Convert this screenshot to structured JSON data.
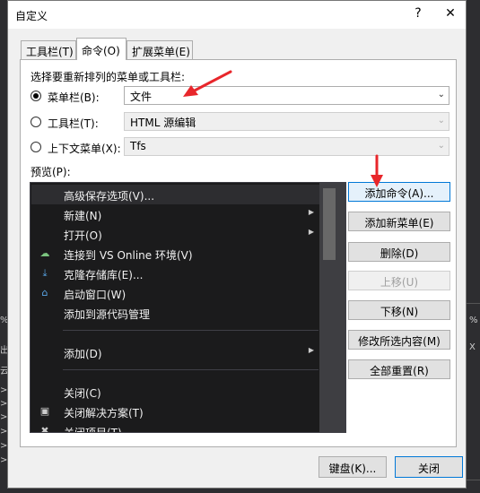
{
  "background": {
    "left_glyphs": [
      "%",
      "出",
      "云",
      "",
      ">",
      ">",
      ">",
      ">",
      ">",
      ">"
    ],
    "right_glyphs": [
      "%",
      "X"
    ]
  },
  "dialog": {
    "title": "自定义",
    "help_label": "?",
    "close_glyph": "✕"
  },
  "tabs": [
    {
      "label": "工具栏(T)",
      "active": false
    },
    {
      "label": "命令(O)",
      "active": true
    },
    {
      "label": "扩展菜单(E)",
      "active": false
    }
  ],
  "choose_label": "选择要重新排列的菜单或工具栏:",
  "options": [
    {
      "label": "菜单栏(B):",
      "value": "文件",
      "checked": true,
      "enabled": true
    },
    {
      "label": "工具栏(T):",
      "value": "HTML 源编辑",
      "checked": false,
      "enabled": false
    },
    {
      "label": "上下文菜单(X):",
      "value": "Tfs",
      "checked": false,
      "enabled": false
    }
  ],
  "preview_label": "预览(P):",
  "menu_items": [
    {
      "text": "高级保存选项(V)...",
      "icon": "",
      "submenu": false
    },
    {
      "text": "新建(N)",
      "icon": "",
      "submenu": true
    },
    {
      "text": "打开(O)",
      "icon": "",
      "submenu": true
    },
    {
      "text": "连接到 VS Online 环境(V)",
      "icon": "☁",
      "submenu": false
    },
    {
      "text": "克隆存储库(E)...",
      "icon": "⤓",
      "submenu": false
    },
    {
      "text": "启动窗口(W)",
      "icon": "⌂",
      "submenu": false
    },
    {
      "text": "添加到源代码管理",
      "icon": "",
      "submenu": false
    },
    {
      "text": "添加(D)",
      "icon": "",
      "submenu": true
    },
    {
      "text": "关闭(C)",
      "icon": "",
      "submenu": false
    },
    {
      "text": "关闭解决方案(T)",
      "icon": "▣",
      "submenu": false
    },
    {
      "text": "关闭项目(T)",
      "icon": "✖",
      "submenu": false
    }
  ],
  "submenu_glyph": "▶",
  "buttons": {
    "add_command": "添加命令(A)...",
    "add_menu": "添加新菜单(E)",
    "delete": "删除(D)",
    "move_up": "上移(U)",
    "move_down": "下移(N)",
    "modify": "修改所选内容(M)",
    "reset_all": "全部重置(R)"
  },
  "footer": {
    "keyboard": "键盘(K)...",
    "close": "关闭"
  },
  "dropdown_glyph": "⌄",
  "colors": {
    "accent": "#0078d7",
    "arrow": "#e8262b",
    "menu_bg": "#1b1b1c"
  }
}
